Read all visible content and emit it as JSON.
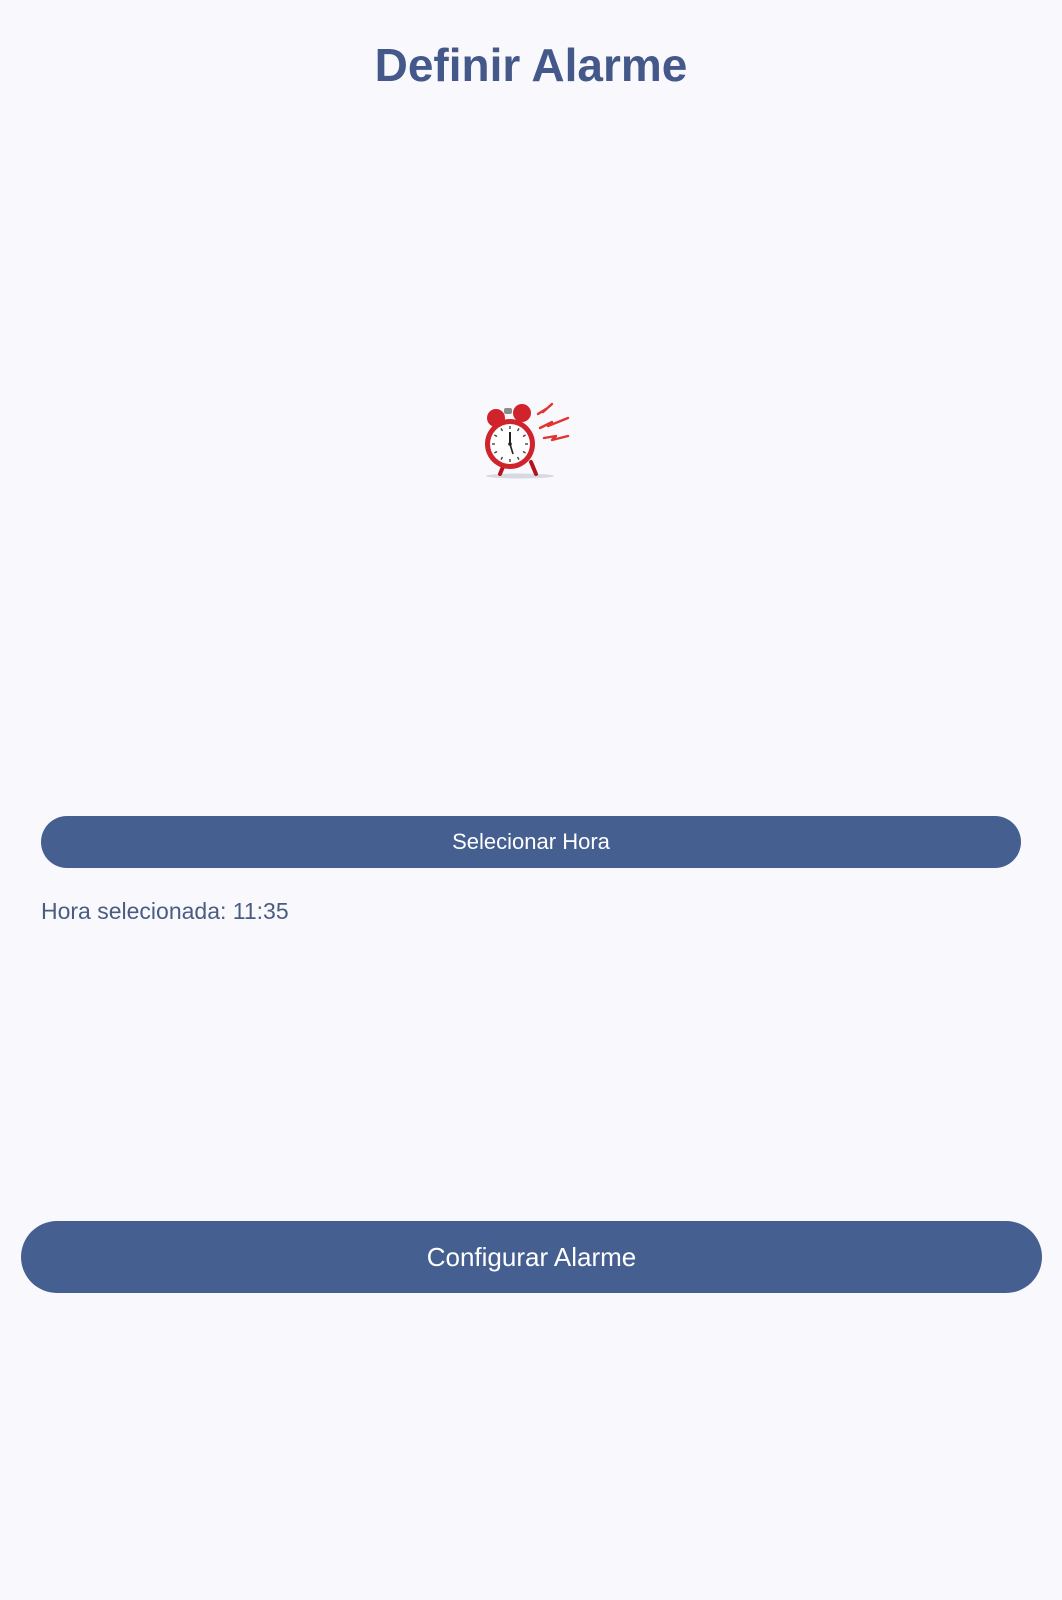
{
  "header": {
    "title": "Definir Alarme"
  },
  "illustration": {
    "icon": "alarm-clock-ringing-icon",
    "colors": {
      "bell": "#d0232b",
      "face": "#ffffff",
      "spark": "#e0342e"
    }
  },
  "actions": {
    "select_time_label": "Selecionar Hora",
    "configure_alarm_label": "Configurar Alarme"
  },
  "status": {
    "selected_time_text": "Hora selecionada: 11:35"
  },
  "theme": {
    "background": "#f9f9fd",
    "primary": "#455f91",
    "title_color": "#44598a",
    "text_color": "#4a5d80"
  }
}
